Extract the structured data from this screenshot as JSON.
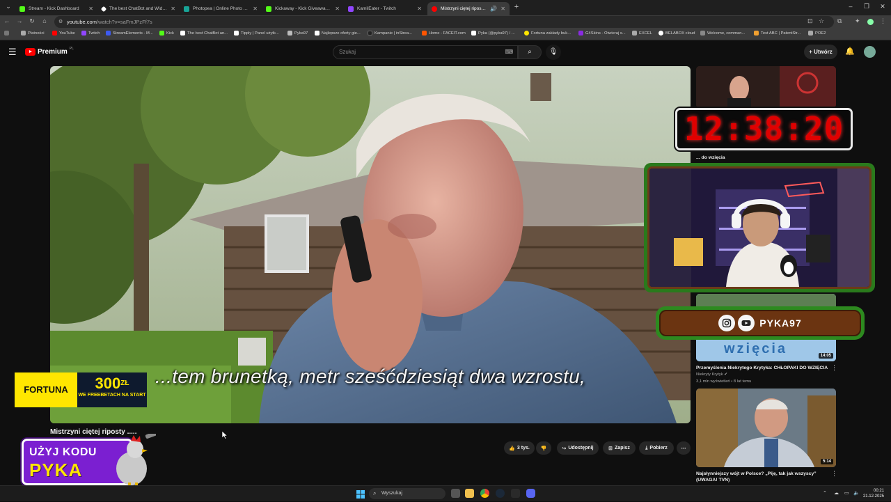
{
  "browser": {
    "tabs": [
      {
        "title": "Stream - Kick Dashboard",
        "color": "#53fc18"
      },
      {
        "title": "The best ChatBot and Widgets",
        "color": "#ffffff"
      },
      {
        "title": "Photopea | Online Photo Editor",
        "color": "#18a497"
      },
      {
        "title": "Kickaway - Kick Giveaway Tool",
        "color": "#53fc18"
      },
      {
        "title": "KamilEater - Twitch",
        "color": "#9146ff"
      },
      {
        "title": "Mistrzyni ciętej riposty ...",
        "color": "#ff0000"
      }
    ],
    "url_domain": "youtube.com",
    "url_path": "/watch?v=saFmJPzFf7s",
    "bookmarks": [
      {
        "label": "Płatności",
        "color": "#aaaaaa"
      },
      {
        "label": "YouTube",
        "color": "#ff0000"
      },
      {
        "label": "Twitch",
        "color": "#9146ff"
      },
      {
        "label": "StreamElements - M...",
        "color": "#3d5af1"
      },
      {
        "label": "Kick",
        "color": "#53fc18"
      },
      {
        "label": "The best ChatBot an...",
        "color": "#ffffff"
      },
      {
        "label": "Tipply | Panel użytk...",
        "color": "#ffffff"
      },
      {
        "label": "Pyka97",
        "color": "#bbbbbb"
      },
      {
        "label": "Najlepsze oferty gie...",
        "color": "#ffffff"
      },
      {
        "label": "Kampanie | inStrea...",
        "color": "#222222"
      },
      {
        "label": "Home - FACEIT.com",
        "color": "#ff5500"
      },
      {
        "label": "Pyka (@pyka97) / ...",
        "color": "#ffffff"
      },
      {
        "label": "Fortuna zakłady buk...",
        "color": "#ffe600"
      },
      {
        "label": "G4Skins - Otwieraj s...",
        "color": "#8a2be2"
      },
      {
        "label": "EXCEL",
        "color": "#aaaaaa"
      },
      {
        "label": "BELABOX cloud",
        "color": "#ffffff"
      },
      {
        "label": "Welcome, comman...",
        "color": "#888888"
      },
      {
        "label": "Test ABC | PatentStr...",
        "color": "#f0a030"
      },
      {
        "label": "POE2",
        "color": "#aaaaaa"
      }
    ]
  },
  "youtube": {
    "logo_text": "Premium",
    "logo_sup": "PL",
    "search_placeholder": "Szukaj",
    "create_label": "Utwórz",
    "video_title": "Mistrzyni ciętej riposty .....",
    "subtitle": "...tem brunetką,  metr sześćdziesiąt dwa wzrostu,",
    "likes": "3 tys.",
    "share_label": "Udostępnij",
    "save_label": "Zapisz",
    "download_label": "Pobierz",
    "recommendations": [
      {
        "title": "... do wzięcia",
        "channel": "",
        "meta": "",
        "duration": ""
      },
      {
        "title": "Przemyślenia Niekrytego Krytyka: CHŁOPAKI DO WZIĘCIA",
        "channel": "Niekryty Krytyk",
        "meta": "3,1 mln wyświetleń • 8 lat temu",
        "duration": "14:05",
        "thumb_text": "wzięcia"
      },
      {
        "title": "Najsłynniejszy wójt w Polsce? „Piję, tak jak wszyscy” (UWAGA! TVN)",
        "channel": "",
        "meta": "",
        "duration": "5:14"
      }
    ]
  },
  "overlays": {
    "timer": "12:38:20",
    "social_handle": "PYKA97",
    "fortuna_brand": "FORTUNA",
    "fortuna_amount": "300",
    "fortuna_currency": "ZŁ",
    "fortuna_sub": "WE FREEBETACH NA START",
    "promo_line1": "UŻYJ KODU",
    "promo_line2": "PYKA"
  },
  "taskbar": {
    "search_placeholder": "Wyszukaj",
    "time": "00:21",
    "date": "21.12.2025"
  }
}
